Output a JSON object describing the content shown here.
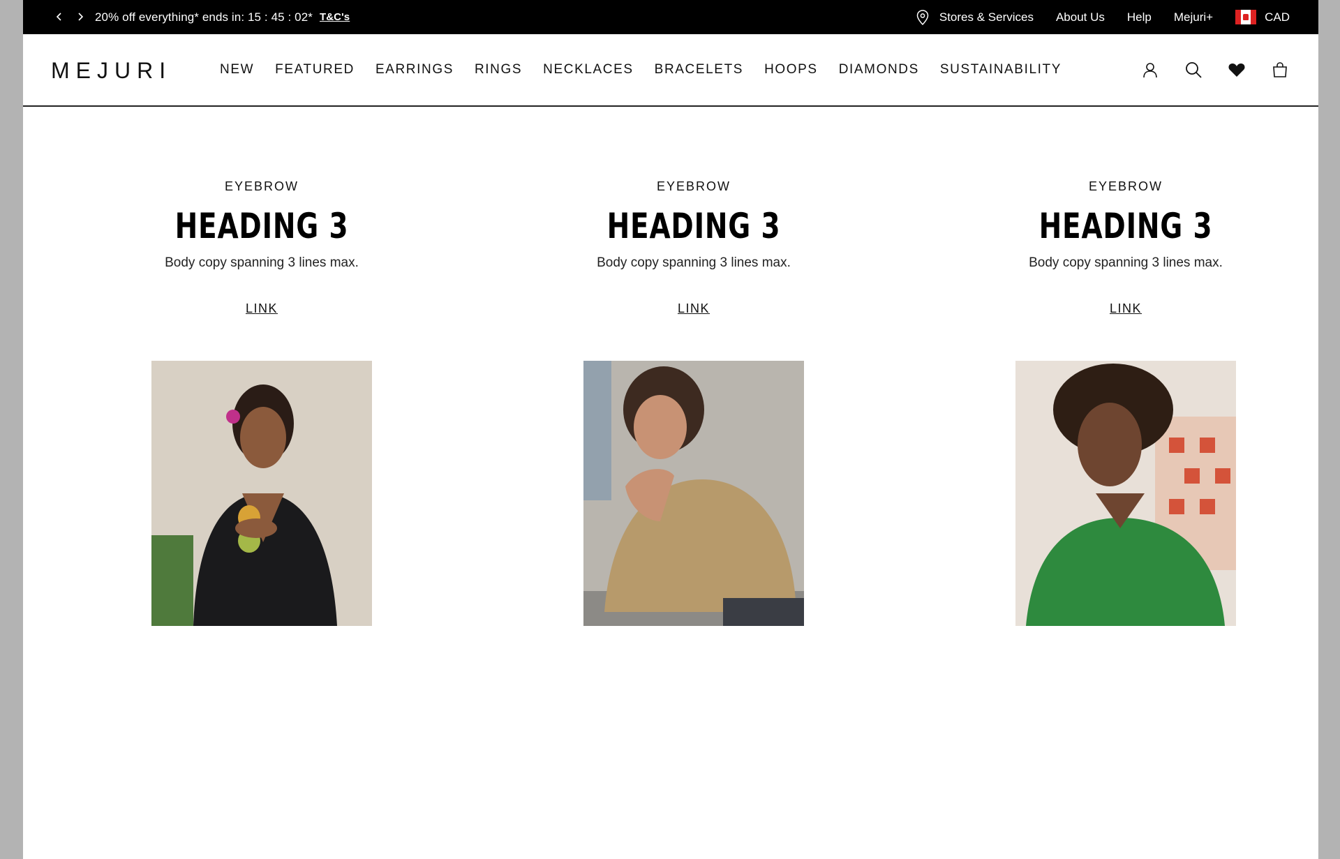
{
  "promo": {
    "message": "20% off everything* ends in: 15 : 45 : 02*",
    "terms_link": "T&C's"
  },
  "utility_nav": {
    "stores": "Stores & Services",
    "about": "About Us",
    "help": "Help",
    "membership": "Mejuri+",
    "currency": "CAD"
  },
  "brand": {
    "logo": "MEJURI"
  },
  "main_nav": {
    "items": [
      "NEW",
      "FEATURED",
      "EARRINGS",
      "RINGS",
      "NECKLACES",
      "BRACELETS",
      "HOOPS",
      "DIAMONDS",
      "SUSTAINABILITY"
    ]
  },
  "cards": [
    {
      "eyebrow": "EYEBROW",
      "heading": "HEADING 3",
      "body": "Body copy spanning 3 lines max.",
      "link": "LINK"
    },
    {
      "eyebrow": "EYEBROW",
      "heading": "HEADING 3",
      "body": "Body copy spanning 3 lines max.",
      "link": "LINK"
    },
    {
      "eyebrow": "EYEBROW",
      "heading": "HEADING 3",
      "body": "Body copy spanning 3 lines max.",
      "link": "LINK"
    }
  ],
  "colors": {
    "promo_bg": "#000000",
    "text": "#111111",
    "page_bg": "#ffffff",
    "outer_bg": "#b3b3b3"
  }
}
